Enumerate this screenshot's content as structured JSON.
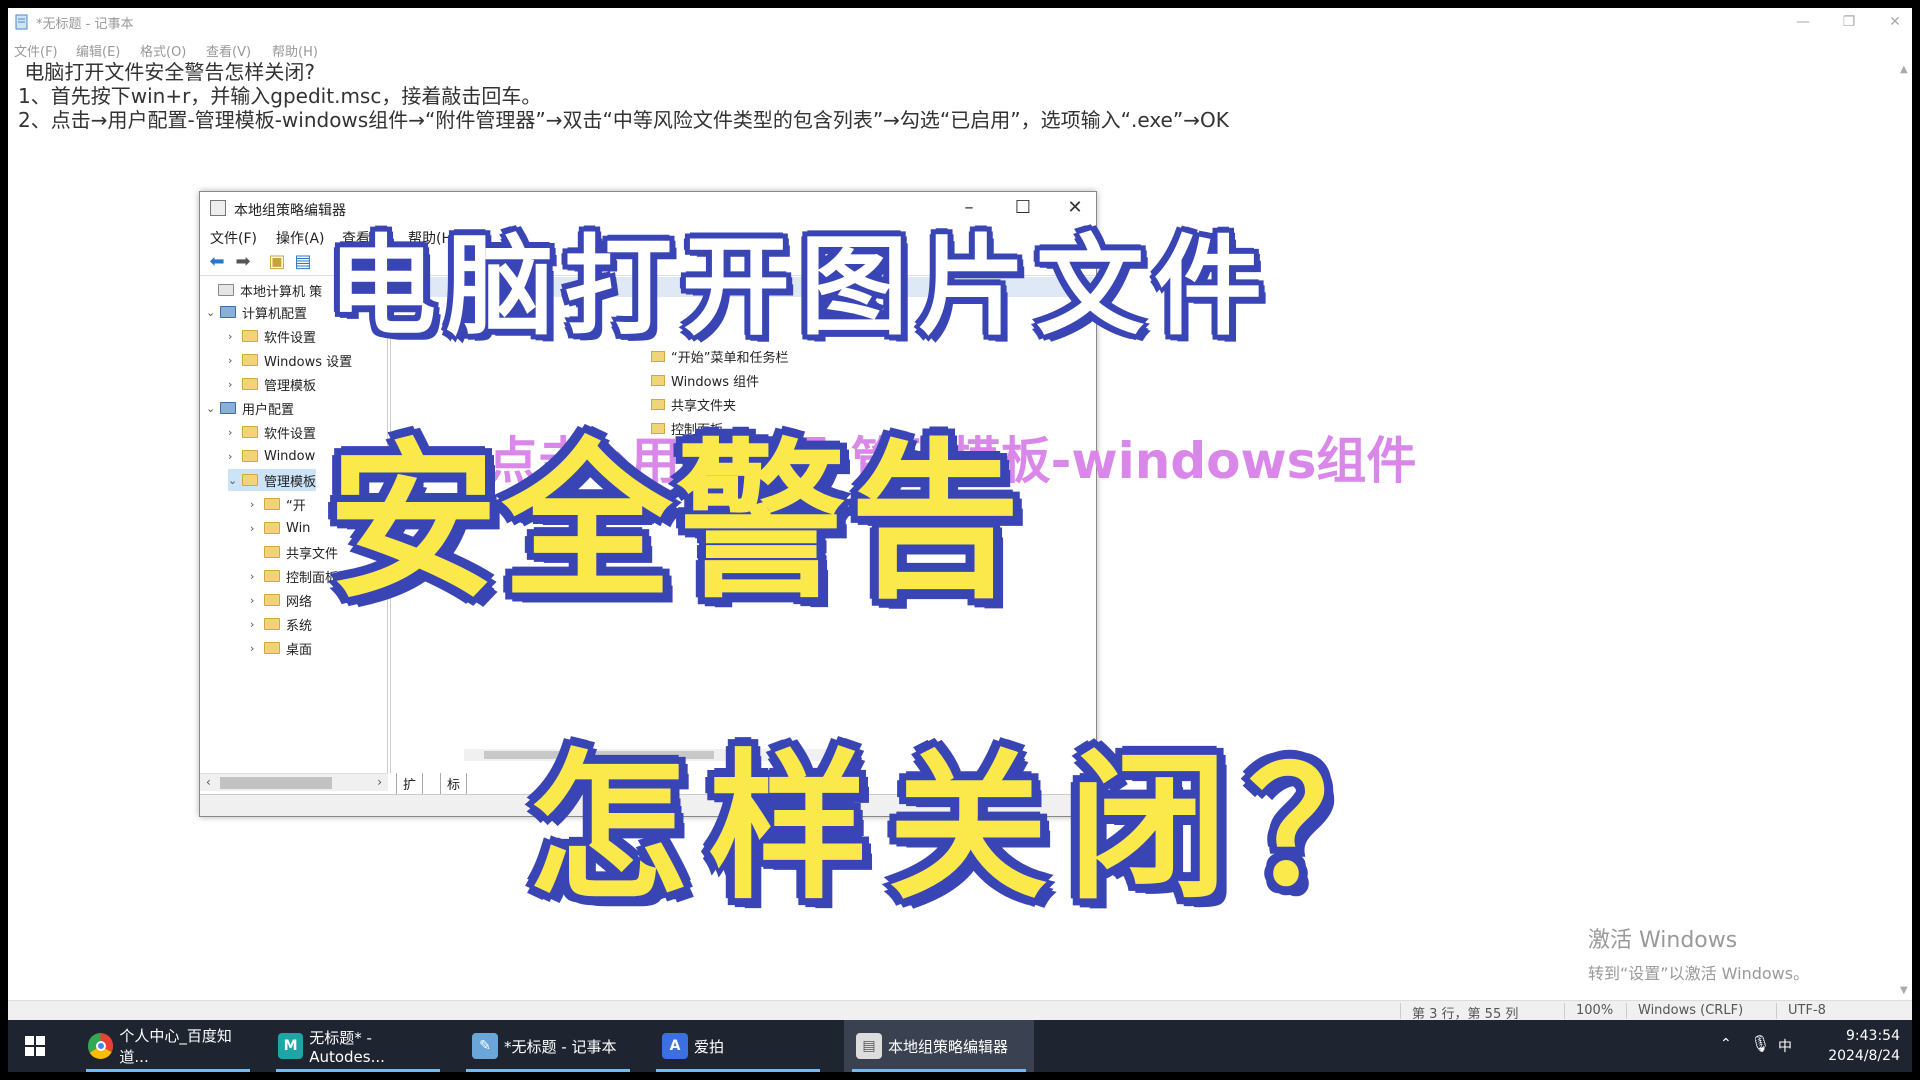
{
  "notepad": {
    "title": "*无标题 - 记事本",
    "menu": [
      "文件(F)",
      "编辑(E)",
      "格式(O)",
      "查看(V)",
      "帮助(H)"
    ],
    "lines": [
      " 电脑打开文件安全警告怎样关闭?",
      "1、首先按下win+r，并输入gpedit.msc，接着敲击回车。",
      "2、点击→用户配置-管理模板-windows组件→“附件管理器”→双击“中等风险文件类型的包含列表”→勾选“已启用”，选项输入“.exe”→OK"
    ],
    "status": {
      "position": "第 3 行，第 55 列",
      "zoom": "100%",
      "line_ending": "Windows (CRLF)",
      "encoding": "UTF-8"
    }
  },
  "watermark": {
    "line1": "激活 Windows",
    "line2": "转到“设置”以激活 Windows。"
  },
  "gpedit": {
    "title": "本地组策略编辑器",
    "menu": [
      "文件(F)",
      "操作(A)",
      "查看(",
      "帮助(H)"
    ],
    "tree": [
      {
        "label": "本地计算机 策",
        "level": 0
      },
      {
        "label": "计算机配置",
        "level": 0
      },
      {
        "label": "软件设置",
        "level": 1
      },
      {
        "label": "Windows 设置",
        "level": 1
      },
      {
        "label": "管理模板",
        "level": 1
      },
      {
        "label": "用户配置",
        "level": 0
      },
      {
        "label": "软件设置",
        "level": 1
      },
      {
        "label": "Window",
        "level": 1
      },
      {
        "label": "管理模板",
        "level": 1
      },
      {
        "label": "“开",
        "level": 2
      },
      {
        "label": "Win",
        "level": 2
      },
      {
        "label": "共享文件",
        "level": 2
      },
      {
        "label": "控制面板",
        "level": 2
      },
      {
        "label": "网络",
        "level": 2
      },
      {
        "label": "系统",
        "level": 2
      },
      {
        "label": "桌面",
        "level": 2
      }
    ],
    "right_items": [
      "“开始”菜单和任务栏",
      "Windows 组件",
      "共享文件夹",
      "控制面板"
    ],
    "tabs": [
      "扩展",
      "标准"
    ]
  },
  "overlay": {
    "pink_line": "点击→用户配置-管理模板-windows组件",
    "line1": "电脑打开图片文件",
    "line2": "安全警告",
    "line3": "怎样关闭？"
  },
  "taskbar": {
    "items": [
      {
        "label": "个人中心_百度知道...",
        "icon": "chrome-icon",
        "icon_color": "#e94235"
      },
      {
        "label": "无标题* - Autodes...",
        "icon": "autodesk-maya-icon",
        "icon_color": "#1fa5a5"
      },
      {
        "label": "*无标题 - 记事本",
        "icon": "notepad-icon",
        "icon_color": "#6aa7d8"
      },
      {
        "label": "爱拍",
        "icon": "aipai-icon",
        "icon_color": "#3c6fe0"
      },
      {
        "label": "本地组策略编辑器",
        "icon": "gpedit-icon",
        "icon_color": "#ddd"
      }
    ],
    "tray": {
      "ime": "中",
      "time": "9:43:54",
      "date": "2024/8/24"
    }
  }
}
